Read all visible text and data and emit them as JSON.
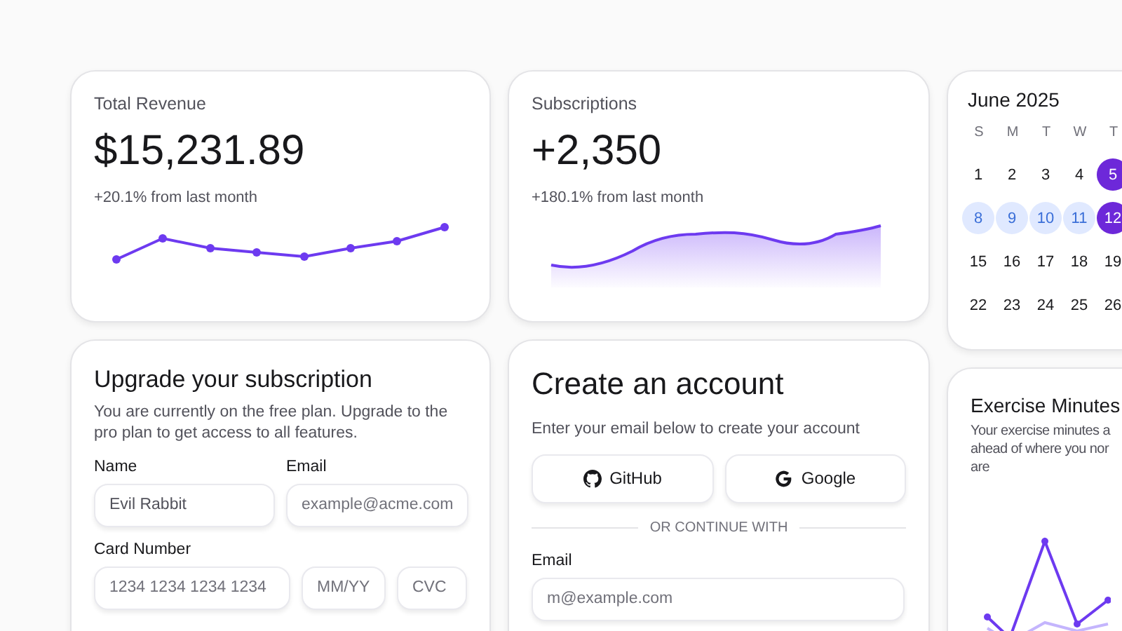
{
  "revenue": {
    "title": "Total Revenue",
    "value": "$15,231.89",
    "change": "+20.1% from last month"
  },
  "subscriptions": {
    "title": "Subscriptions",
    "value": "+2,350",
    "change": "+180.1% from last month"
  },
  "calendar": {
    "title": "June 2025",
    "weekdays": [
      "S",
      "M",
      "T",
      "W",
      "T"
    ],
    "weeks": [
      [
        {
          "day": "1",
          "selected": false,
          "in_range": false
        },
        {
          "day": "2",
          "selected": false,
          "in_range": false
        },
        {
          "day": "3",
          "selected": false,
          "in_range": false
        },
        {
          "day": "4",
          "selected": false,
          "in_range": false
        },
        {
          "day": "5",
          "selected": true,
          "in_range": false
        }
      ],
      [
        {
          "day": "8",
          "selected": false,
          "in_range": true
        },
        {
          "day": "9",
          "selected": false,
          "in_range": true
        },
        {
          "day": "10",
          "selected": false,
          "in_range": true
        },
        {
          "day": "11",
          "selected": false,
          "in_range": true
        },
        {
          "day": "12",
          "selected": true,
          "in_range": false
        }
      ],
      [
        {
          "day": "15",
          "selected": false,
          "in_range": false
        },
        {
          "day": "16",
          "selected": false,
          "in_range": false
        },
        {
          "day": "17",
          "selected": false,
          "in_range": false
        },
        {
          "day": "18",
          "selected": false,
          "in_range": false
        },
        {
          "day": "19",
          "selected": false,
          "in_range": false
        }
      ],
      [
        {
          "day": "22",
          "selected": false,
          "in_range": false
        },
        {
          "day": "23",
          "selected": false,
          "in_range": false
        },
        {
          "day": "24",
          "selected": false,
          "in_range": false
        },
        {
          "day": "25",
          "selected": false,
          "in_range": false
        },
        {
          "day": "26",
          "selected": false,
          "in_range": false
        }
      ]
    ]
  },
  "upgrade": {
    "title": "Upgrade your subscription",
    "description": "You are currently on the free plan. Upgrade to the pro plan to get access to all features.",
    "name": {
      "label": "Name",
      "value": "Evil Rabbit"
    },
    "email": {
      "label": "Email",
      "placeholder": "example@acme.com"
    },
    "card": {
      "label": "Card Number",
      "placeholder": "1234 1234 1234 1234",
      "expiry_placeholder": "MM/YY",
      "cvc_placeholder": "CVC"
    }
  },
  "create_account": {
    "title": "Create an account",
    "description": "Enter your email below to create your account",
    "providers": [
      {
        "kind": "github",
        "label": "GitHub"
      },
      {
        "kind": "google",
        "label": "Google"
      }
    ],
    "divider": "OR CONTINUE WITH",
    "email": {
      "label": "Email",
      "placeholder": "m@example.com"
    }
  },
  "exercise": {
    "title": "Exercise Minutes",
    "description_lines": [
      "Your exercise minutes a",
      "ahead of where you nor",
      "are"
    ]
  }
}
